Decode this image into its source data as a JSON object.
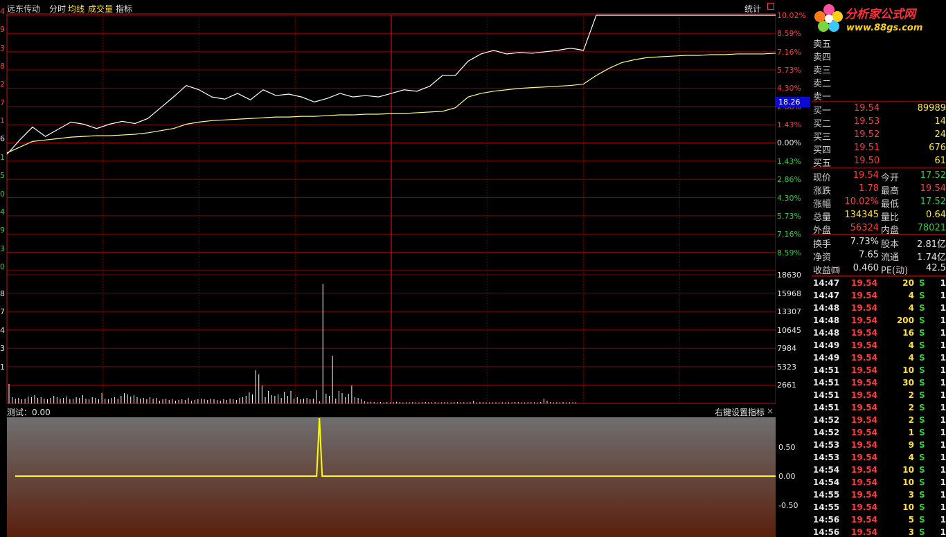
{
  "header": {
    "stock_name": "远东传动",
    "tabs": [
      "分时",
      "均线",
      "成交量",
      "指标"
    ],
    "stats_label": "统计"
  },
  "price_axis": {
    "left_labels": [
      "4",
      "9",
      "3",
      "8",
      "2",
      "7",
      "1",
      "6",
      "1",
      "5",
      "0",
      "4",
      "9",
      "3",
      "0"
    ],
    "right_labels": [
      "10.02%",
      "8.59%",
      "7.16%",
      "5.73%",
      "4.30%",
      "2.86%",
      "1.43%",
      "0.00%",
      "1.43%",
      "2.86%",
      "4.30%",
      "5.73%",
      "7.16%",
      "8.59%"
    ],
    "cursor_price": "18.26"
  },
  "volume_axis": {
    "left_labels": [
      "8",
      "7",
      "4",
      "3",
      "1"
    ],
    "right_labels": [
      "18630",
      "15968",
      "13307",
      "10645",
      "7984",
      "5323",
      "2661"
    ]
  },
  "indicator": {
    "name_label": "测试：0.00",
    "settings_label": "右键设置指标",
    "close_icon": "×",
    "axis_labels": [
      "0.50",
      "0.00",
      "-0.50"
    ]
  },
  "chart_data": {
    "type": "line",
    "title": "",
    "xlabel": "",
    "ylabel": "",
    "prev_close": 17.76,
    "limit_up": 19.54,
    "series": [
      {
        "values": [
          17.6,
          17.8,
          17.98,
          17.85,
          17.95,
          18.05,
          18.02,
          17.96,
          18.02,
          18.06,
          18.03,
          18.1,
          18.25,
          18.4,
          18.56,
          18.5,
          18.4,
          18.37,
          18.45,
          18.36,
          18.5,
          18.42,
          18.44,
          18.4,
          18.33,
          18.38,
          18.45,
          18.4,
          18.42,
          18.4,
          18.45,
          18.5,
          18.48,
          18.55,
          18.7,
          18.7,
          18.9,
          19.0,
          19.05,
          19.0,
          19.02,
          19.01,
          19.03,
          19.05,
          19.08,
          19.05,
          19.54,
          19.54,
          19.54,
          19.54,
          19.54,
          19.54,
          19.54,
          19.54,
          19.54,
          19.54,
          19.54,
          19.54,
          19.54,
          19.54,
          19.54
        ]
      },
      {
        "values": [
          17.62,
          17.7,
          17.78,
          17.8,
          17.82,
          17.84,
          17.85,
          17.86,
          17.86,
          17.87,
          17.88,
          17.9,
          17.93,
          17.96,
          18.02,
          18.05,
          18.07,
          18.08,
          18.09,
          18.1,
          18.11,
          18.12,
          18.12,
          18.13,
          18.13,
          18.14,
          18.15,
          18.15,
          18.16,
          18.16,
          18.17,
          18.17,
          18.18,
          18.19,
          18.2,
          18.25,
          18.4,
          18.45,
          18.48,
          18.5,
          18.52,
          18.53,
          18.54,
          18.55,
          18.56,
          18.58,
          18.7,
          18.8,
          18.88,
          18.92,
          18.95,
          18.96,
          18.97,
          18.98,
          18.98,
          18.99,
          18.99,
          19.0,
          19.0,
          19.0,
          19.01
        ]
      }
    ],
    "volume_values": [
      2800,
      900,
      700,
      800,
      600,
      700,
      1000,
      900,
      1200,
      800,
      900,
      700,
      600,
      800,
      1100,
      900,
      700,
      800,
      1000,
      600,
      700,
      900,
      800,
      1200,
      700,
      600,
      900,
      800,
      600,
      1500,
      700,
      600,
      800,
      900,
      700,
      1100,
      1500,
      1300,
      1000,
      1200,
      900,
      700,
      800,
      600,
      900,
      700,
      800,
      400,
      600,
      700,
      500,
      600,
      400,
      500,
      600,
      500,
      800,
      400,
      500,
      600,
      700,
      600,
      500,
      700,
      600,
      500,
      400,
      600,
      500,
      700,
      600,
      500,
      800,
      900,
      1100,
      1600,
      1300,
      4800,
      4200,
      2600,
      900,
      1800,
      1200,
      1100,
      1300,
      800,
      1700,
      1100,
      1800,
      700,
      900,
      600,
      700,
      800,
      600,
      700,
      1900,
      300,
      17300,
      1400,
      1100,
      6900,
      700,
      1800,
      1500,
      900,
      1400,
      2600,
      900,
      800,
      600,
      300,
      200,
      250,
      200,
      150,
      200,
      150,
      200,
      150,
      200,
      250,
      200,
      150,
      180,
      160,
      200,
      170,
      150,
      200,
      220,
      180,
      160,
      200,
      150,
      170,
      190,
      150,
      160,
      180,
      200,
      150,
      170,
      160,
      180,
      400,
      160,
      180,
      200,
      150,
      170,
      160,
      180,
      150,
      190,
      170,
      160,
      150,
      200,
      180,
      160,
      150,
      190,
      170,
      160,
      150,
      200,
      700,
      400,
      200,
      150,
      180,
      160,
      200,
      150,
      170,
      160,
      180
    ],
    "indicator_values": {
      "spike_position": 0.4065,
      "spike_value": 1.0,
      "baseline": 0.0
    }
  },
  "quote": {
    "sell_levels": [
      {
        "label": "卖五",
        "price": "",
        "vol": ""
      },
      {
        "label": "卖四",
        "price": "",
        "vol": ""
      },
      {
        "label": "卖三",
        "price": "",
        "vol": ""
      },
      {
        "label": "卖二",
        "price": "",
        "vol": ""
      },
      {
        "label": "卖一",
        "price": "",
        "vol": ""
      }
    ],
    "buy_levels": [
      {
        "label": "买一",
        "price": "19.54",
        "vol": "89989"
      },
      {
        "label": "买二",
        "price": "19.53",
        "vol": "14"
      },
      {
        "label": "买三",
        "price": "19.52",
        "vol": "24"
      },
      {
        "label": "买四",
        "price": "19.51",
        "vol": "676"
      },
      {
        "label": "买五",
        "price": "19.50",
        "vol": "61"
      }
    ],
    "stats": [
      {
        "l1": "现价",
        "v1": "19.54",
        "c1": "red",
        "l2": "今开",
        "v2": "17.52",
        "c2": "grn"
      },
      {
        "l1": "涨跌",
        "v1": "1.78",
        "c1": "red",
        "l2": "最高",
        "v2": "19.54",
        "c2": "red"
      },
      {
        "l1": "涨幅",
        "v1": "10.02%",
        "c1": "red",
        "l2": "最低",
        "v2": "17.52",
        "c2": "grn"
      },
      {
        "l1": "总量",
        "v1": "134345",
        "c1": "yel",
        "l2": "量比",
        "v2": "0.64",
        "c2": "yel"
      },
      {
        "l1": "外盘",
        "v1": "56324",
        "c1": "red",
        "l2": "内盘",
        "v2": "78021",
        "c2": "grn"
      }
    ],
    "fundamentals": [
      {
        "l1": "换手",
        "v1": "7.73%",
        "l2": "股本",
        "v2": "2.81亿"
      },
      {
        "l1": "净资",
        "v1": "7.65",
        "l2": "流通",
        "v2": "1.74亿"
      },
      {
        "l1": "收益㈣",
        "v1": "0.460",
        "l2": "PE(动)",
        "v2": "42.5"
      }
    ]
  },
  "ticks": [
    {
      "time": "14:47",
      "price": "19.54",
      "vol": "20",
      "side": "S",
      "n": "1"
    },
    {
      "time": "14:47",
      "price": "19.54",
      "vol": "4",
      "side": "S",
      "n": "1"
    },
    {
      "time": "14:48",
      "price": "19.54",
      "vol": "4",
      "side": "S",
      "n": "1"
    },
    {
      "time": "14:48",
      "price": "19.54",
      "vol": "200",
      "side": "S",
      "n": "1"
    },
    {
      "time": "14:48",
      "price": "19.54",
      "vol": "16",
      "side": "S",
      "n": "1"
    },
    {
      "time": "14:49",
      "price": "19.54",
      "vol": "4",
      "side": "S",
      "n": "1"
    },
    {
      "time": "14:49",
      "price": "19.54",
      "vol": "4",
      "side": "S",
      "n": "1"
    },
    {
      "time": "14:51",
      "price": "19.54",
      "vol": "10",
      "side": "S",
      "n": "1"
    },
    {
      "time": "14:51",
      "price": "19.54",
      "vol": "30",
      "side": "S",
      "n": "1"
    },
    {
      "time": "14:51",
      "price": "19.54",
      "vol": "2",
      "side": "S",
      "n": "1"
    },
    {
      "time": "14:51",
      "price": "19.54",
      "vol": "2",
      "side": "S",
      "n": "1"
    },
    {
      "time": "14:52",
      "price": "19.54",
      "vol": "2",
      "side": "S",
      "n": "1"
    },
    {
      "time": "14:52",
      "price": "19.54",
      "vol": "1",
      "side": "S",
      "n": "1"
    },
    {
      "time": "14:53",
      "price": "19.54",
      "vol": "9",
      "side": "S",
      "n": "1"
    },
    {
      "time": "14:53",
      "price": "19.54",
      "vol": "4",
      "side": "S",
      "n": "1"
    },
    {
      "time": "14:54",
      "price": "19.54",
      "vol": "10",
      "side": "S",
      "n": "1"
    },
    {
      "time": "14:54",
      "price": "19.54",
      "vol": "10",
      "side": "S",
      "n": "1"
    },
    {
      "time": "14:55",
      "price": "19.54",
      "vol": "3",
      "side": "S",
      "n": "1"
    },
    {
      "time": "14:55",
      "price": "19.54",
      "vol": "10",
      "side": "S",
      "n": "1"
    },
    {
      "time": "14:56",
      "price": "19.54",
      "vol": "5",
      "side": "S",
      "n": "1"
    },
    {
      "time": "14:56",
      "price": "19.54",
      "vol": "3",
      "side": "S",
      "n": "1"
    }
  ],
  "logo": {
    "title": "分析家公式网",
    "url": "www.88gs.com"
  },
  "colors": {
    "grid": "#8b0000",
    "price_line": "#ffffff",
    "avg_line": "#ffff80",
    "indicator_line": "#ffff00",
    "up": "#ff3b3b",
    "down": "#28d23c",
    "volume": "#ffffff"
  }
}
